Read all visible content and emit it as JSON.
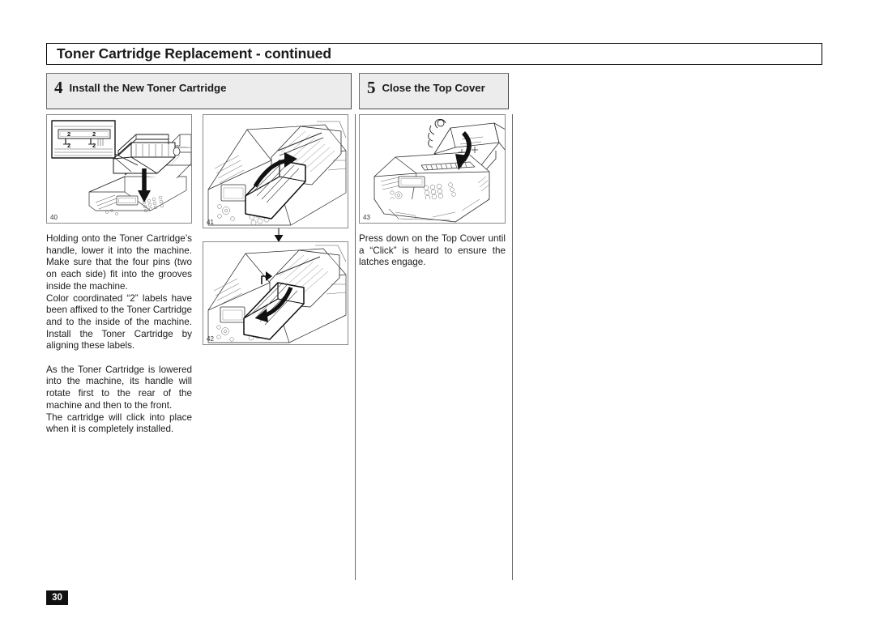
{
  "document": {
    "title": "Toner Cartridge Replacement - continued",
    "page_number": "30"
  },
  "steps": [
    {
      "number": "4",
      "label": "Install the New Toner Cartridge",
      "figures": [
        "40",
        "41",
        "42"
      ],
      "paragraphs": [
        "Holding onto the Toner Cartridge’s handle, lower it into the machine. Make sure that the four pins (two on each side) fit into the grooves inside the machine.",
        "Color coordinated “2” labels have been affixed to the Toner Cartridge and to the inside of the machine. Install the Toner Cartridge by aligning these labels.",
        "As the Toner Cartridge is lowered into the machine, its handle will rotate first to the rear of the machine and then to the front.",
        "The cartridge will click into place when it is completely installed."
      ]
    },
    {
      "number": "5",
      "label": "Close the Top Cover",
      "figures": [
        "43"
      ],
      "paragraphs": [
        "Press down on the Top Cover until a “Click” is heard to ensure the latches engage."
      ]
    }
  ],
  "figures": {
    "fig40": {
      "number": "40",
      "caption_labels": [
        "2",
        "2",
        "2",
        "2"
      ],
      "description": "Fax machine with top cover open, toner cartridge being lowered in; magnified inset at upper-left shows four color-coordinated “2” alignment labels on the cartridge pins and machine grooves"
    },
    "fig41": {
      "number": "41",
      "description": "Close-up of toner cartridge seated in machine with curved arrow showing handle rotating toward the rear"
    },
    "fig42": {
      "number": "42",
      "description": "Close-up of toner cartridge with curved arrow showing handle rotating forward to the front"
    },
    "fig43": {
      "number": "43",
      "description": "Fax machine with top cover being pressed down closed, large arrow pointing down"
    }
  },
  "inset_labels": {
    "top_left": "2",
    "top_right": "2",
    "bottom_left": "2",
    "bottom_right": "2"
  },
  "colors": {
    "page_background": "#ffffff",
    "text": "#1c1c1c",
    "rule": "#6a6a6a",
    "step_header_fill": "#ececec",
    "step_header_border": "#6e6e6e",
    "badge_fill": "#111111",
    "badge_text": "#ffffff"
  }
}
